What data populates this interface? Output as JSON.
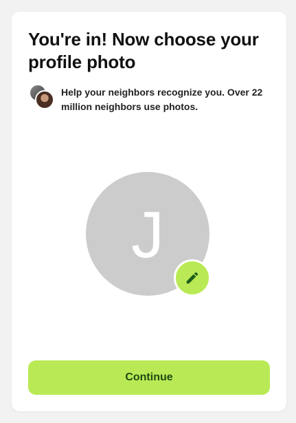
{
  "onboarding": {
    "title": "You're in! Now choose your profile photo",
    "subtitle": "Help your neighbors recognize you. Over 22 million neighbors use photos.",
    "profile_photo": {
      "initial": "J",
      "placeholder_color": "#cccccc"
    },
    "edit_icon": "pencil-icon",
    "continue_label": "Continue",
    "colors": {
      "accent": "#b9ea55",
      "accent_text": "#1f4a12",
      "icon": "#1f5e1b"
    }
  }
}
